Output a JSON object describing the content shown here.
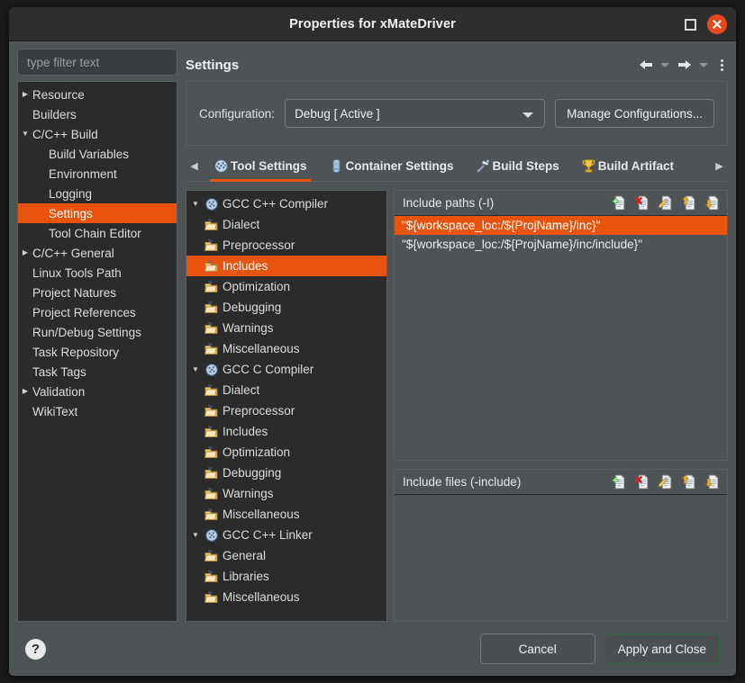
{
  "window": {
    "title": "Properties for xMateDriver",
    "maximize_label": "Maximize",
    "close_label": "Close"
  },
  "sidebar": {
    "filter_placeholder": "type filter text",
    "filter_value": "",
    "items": [
      {
        "label": "Resource",
        "depth": 0,
        "arrow": "collapsed",
        "selected": false
      },
      {
        "label": "Builders",
        "depth": 0,
        "arrow": "none",
        "selected": false
      },
      {
        "label": "C/C++ Build",
        "depth": 0,
        "arrow": "expanded",
        "selected": false
      },
      {
        "label": "Build Variables",
        "depth": 1,
        "arrow": "none",
        "selected": false
      },
      {
        "label": "Environment",
        "depth": 1,
        "arrow": "none",
        "selected": false
      },
      {
        "label": "Logging",
        "depth": 1,
        "arrow": "none",
        "selected": false
      },
      {
        "label": "Settings",
        "depth": 1,
        "arrow": "none",
        "selected": true
      },
      {
        "label": "Tool Chain Editor",
        "depth": 1,
        "arrow": "none",
        "selected": false
      },
      {
        "label": "C/C++ General",
        "depth": 0,
        "arrow": "collapsed",
        "selected": false
      },
      {
        "label": "Linux Tools Path",
        "depth": 0,
        "arrow": "none",
        "selected": false
      },
      {
        "label": "Project Natures",
        "depth": 0,
        "arrow": "none",
        "selected": false
      },
      {
        "label": "Project References",
        "depth": 0,
        "arrow": "none",
        "selected": false
      },
      {
        "label": "Run/Debug Settings",
        "depth": 0,
        "arrow": "none",
        "selected": false
      },
      {
        "label": "Task Repository",
        "depth": 0,
        "arrow": "none",
        "selected": false
      },
      {
        "label": "Task Tags",
        "depth": 0,
        "arrow": "none",
        "selected": false
      },
      {
        "label": "Validation",
        "depth": 0,
        "arrow": "collapsed",
        "selected": false
      },
      {
        "label": "WikiText",
        "depth": 0,
        "arrow": "none",
        "selected": false
      }
    ]
  },
  "page": {
    "title": "Settings",
    "nav": {
      "back_label": "Back",
      "back_menu_label": "Back history",
      "forward_label": "Forward",
      "forward_menu_label": "Forward history",
      "menu_label": "View menu"
    }
  },
  "configuration": {
    "label": "Configuration:",
    "selected": "Debug [ Active ]",
    "options": [
      "Debug [ Active ]"
    ],
    "manage_button": "Manage Configurations..."
  },
  "tabs": {
    "scroll_left": "◀",
    "scroll_right": "▶",
    "items": [
      {
        "label": "Tool Settings",
        "icon": "tools-icon",
        "active": true
      },
      {
        "label": "Container Settings",
        "icon": "column-icon",
        "active": false
      },
      {
        "label": "Build Steps",
        "icon": "hammer-icon",
        "active": false
      },
      {
        "label": "Build Artifact",
        "icon": "trophy-icon",
        "active": false
      }
    ]
  },
  "options_tree": {
    "items": [
      {
        "label": "GCC C++ Compiler",
        "type": "tool",
        "arrow": "expanded",
        "selected": false
      },
      {
        "label": "Dialect",
        "type": "folder",
        "arrow": "none",
        "selected": false
      },
      {
        "label": "Preprocessor",
        "type": "folder",
        "arrow": "none",
        "selected": false
      },
      {
        "label": "Includes",
        "type": "folder",
        "arrow": "none",
        "selected": true
      },
      {
        "label": "Optimization",
        "type": "folder",
        "arrow": "none",
        "selected": false
      },
      {
        "label": "Debugging",
        "type": "folder",
        "arrow": "none",
        "selected": false
      },
      {
        "label": "Warnings",
        "type": "folder",
        "arrow": "none",
        "selected": false
      },
      {
        "label": "Miscellaneous",
        "type": "folder",
        "arrow": "none",
        "selected": false
      },
      {
        "label": "GCC C Compiler",
        "type": "tool",
        "arrow": "expanded",
        "selected": false
      },
      {
        "label": "Dialect",
        "type": "folder",
        "arrow": "none",
        "selected": false
      },
      {
        "label": "Preprocessor",
        "type": "folder",
        "arrow": "none",
        "selected": false
      },
      {
        "label": "Includes",
        "type": "folder",
        "arrow": "none",
        "selected": false
      },
      {
        "label": "Optimization",
        "type": "folder",
        "arrow": "none",
        "selected": false
      },
      {
        "label": "Debugging",
        "type": "folder",
        "arrow": "none",
        "selected": false
      },
      {
        "label": "Warnings",
        "type": "folder",
        "arrow": "none",
        "selected": false
      },
      {
        "label": "Miscellaneous",
        "type": "folder",
        "arrow": "none",
        "selected": false
      },
      {
        "label": "GCC C++ Linker",
        "type": "tool",
        "arrow": "expanded",
        "selected": false
      },
      {
        "label": "General",
        "type": "folder",
        "arrow": "none",
        "selected": false
      },
      {
        "label": "Libraries",
        "type": "folder",
        "arrow": "none",
        "selected": false
      },
      {
        "label": "Miscellaneous",
        "type": "folder",
        "arrow": "none",
        "selected": false
      }
    ]
  },
  "include_paths_panel": {
    "title": "Include paths (-I)",
    "tools": [
      {
        "name": "add-icon",
        "label": "Add"
      },
      {
        "name": "delete-icon",
        "label": "Delete"
      },
      {
        "name": "edit-icon",
        "label": "Edit"
      },
      {
        "name": "move-up-icon",
        "label": "Move Up"
      },
      {
        "name": "move-down-icon",
        "label": "Move Down"
      }
    ],
    "rows": [
      {
        "value": "\"${workspace_loc:/${ProjName}/inc}\"",
        "selected": true
      },
      {
        "value": "\"${workspace_loc:/${ProjName}/inc/include}\"",
        "selected": false
      }
    ]
  },
  "include_files_panel": {
    "title": "Include files (-include)",
    "tools": [
      {
        "name": "add-icon",
        "label": "Add"
      },
      {
        "name": "delete-icon",
        "label": "Delete"
      },
      {
        "name": "edit-icon",
        "label": "Edit"
      },
      {
        "name": "move-up-icon",
        "label": "Move Up"
      },
      {
        "name": "move-down-icon",
        "label": "Move Down"
      }
    ],
    "rows": []
  },
  "footer": {
    "help_label": "?",
    "cancel": "Cancel",
    "apply_and_close": "Apply and Close"
  },
  "colors": {
    "accent_orange": "#e8540e",
    "window_bg": "#4e5456",
    "tree_bg": "#2b2b2b",
    "titlebar_bg": "#2e2e2e",
    "close_button": "#e8481c",
    "border": "#5a5f61",
    "default_button_border": "#2f6a46"
  }
}
